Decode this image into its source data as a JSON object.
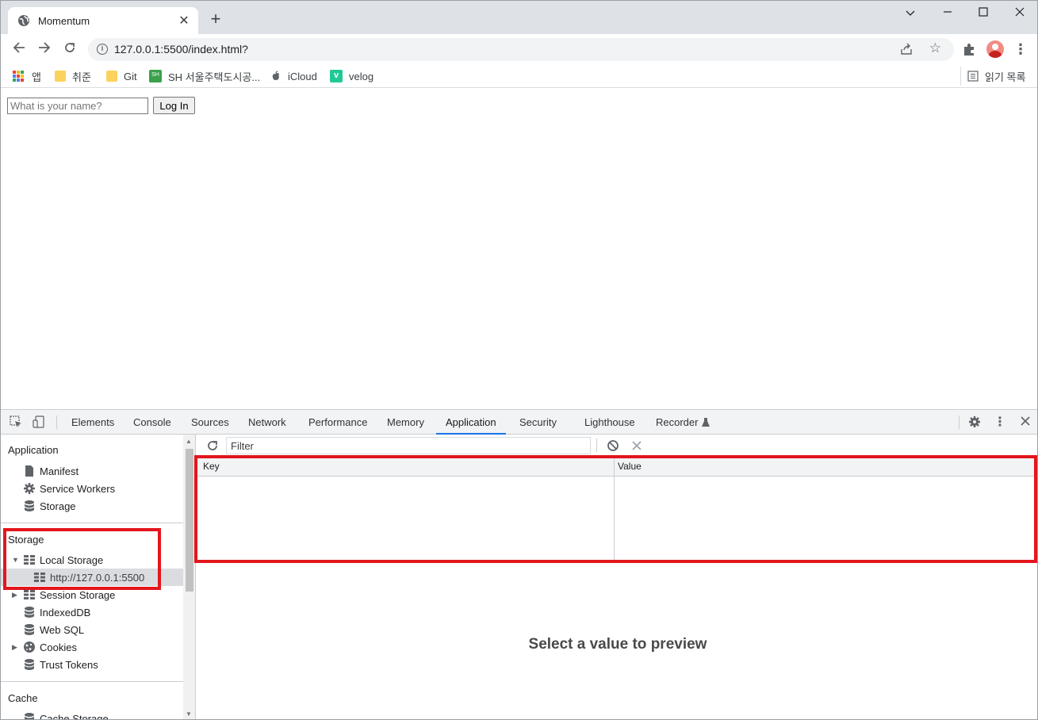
{
  "browser": {
    "tab_title": "Momentum",
    "url": "127.0.0.1:5500/index.html?",
    "window_controls": [
      "chevron-down-icon",
      "minimize-icon",
      "maximize-icon",
      "close-icon"
    ]
  },
  "bookmarks": {
    "items": [
      {
        "label": "앱",
        "icon": "apps-grid-icon"
      },
      {
        "label": "취준",
        "icon": "folder-icon"
      },
      {
        "label": "Git",
        "icon": "folder-icon"
      },
      {
        "label": "SH 서울주택도시공...",
        "icon": "sh-logo-icon"
      },
      {
        "label": "iCloud",
        "icon": "apple-icon"
      },
      {
        "label": "velog",
        "icon": "velog-icon"
      }
    ],
    "reading_list": "읽기 목록"
  },
  "page": {
    "name_placeholder": "What is your name?",
    "login_label": "Log In"
  },
  "devtools": {
    "tabs": [
      "Elements",
      "Console",
      "Sources",
      "Network",
      "Performance",
      "Memory",
      "Application",
      "Security",
      "Lighthouse",
      "Recorder"
    ],
    "active_tab": "Application",
    "sidebar": {
      "application_head": "Application",
      "application_items": [
        "Manifest",
        "Service Workers",
        "Storage"
      ],
      "storage_head": "Storage",
      "local_storage": "Local Storage",
      "local_storage_origin": "http://127.0.0.1:5500",
      "storage_items": [
        "Session Storage",
        "IndexedDB",
        "Web SQL",
        "Cookies",
        "Trust Tokens"
      ],
      "cache_head": "Cache",
      "cache_items": [
        "Cache Storage"
      ]
    },
    "main": {
      "filter_placeholder": "Filter",
      "columns": [
        "Key",
        "Value"
      ],
      "preview_text": "Select a value to preview"
    },
    "highlight_color": "#e3161c",
    "accent_color": "#1a73e8"
  }
}
